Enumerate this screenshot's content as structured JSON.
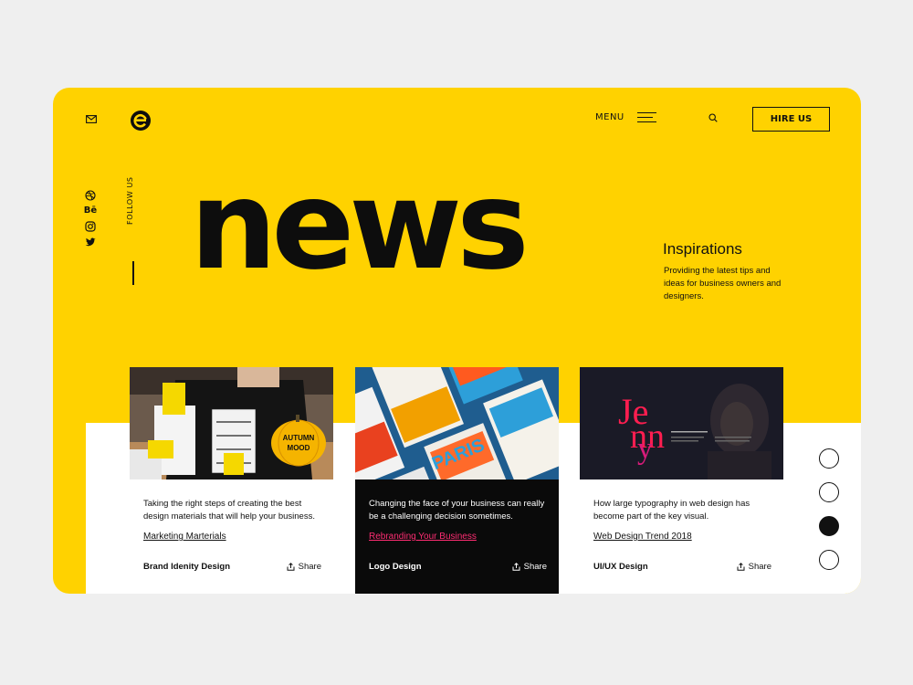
{
  "header": {
    "menu_label": "MENU",
    "hire_label": "HIRE US"
  },
  "social": {
    "icons": [
      "dribbble-icon",
      "behance-icon",
      "instagram-icon",
      "twitter-icon"
    ],
    "behance_text": "Bē",
    "follow_label": "FOLLOW US"
  },
  "hero": {
    "headline": "news",
    "subtitle": "Inspirations",
    "text": "Providing the latest tips and ideas for business owners and designers."
  },
  "cards": [
    {
      "description": "Taking the right steps of creating the best design materials that will help your business.",
      "link": "Marketing Marterials",
      "category": "Brand Idenity Design",
      "share": "Share",
      "image_text": [
        "AUTUMN",
        "MOOD"
      ]
    },
    {
      "description": "Changing the face of your business can really be a challenging decision sometimes.",
      "link": "Rebranding Your Business",
      "category": "Logo Design",
      "share": "Share",
      "image_text": [
        "PARIS"
      ]
    },
    {
      "description": "How large typography in web design has become part of the key visual.",
      "link": "Web Design Trend 2018",
      "category": "UI/UX Design",
      "share": "Share",
      "image_text": [
        "Je",
        "nn",
        "y"
      ]
    }
  ],
  "pager": {
    "count": 4,
    "active_index": 2
  },
  "colors": {
    "brand": "#ffd200",
    "dark": "#0a0a0a",
    "link_accent": "#ff2d73"
  }
}
